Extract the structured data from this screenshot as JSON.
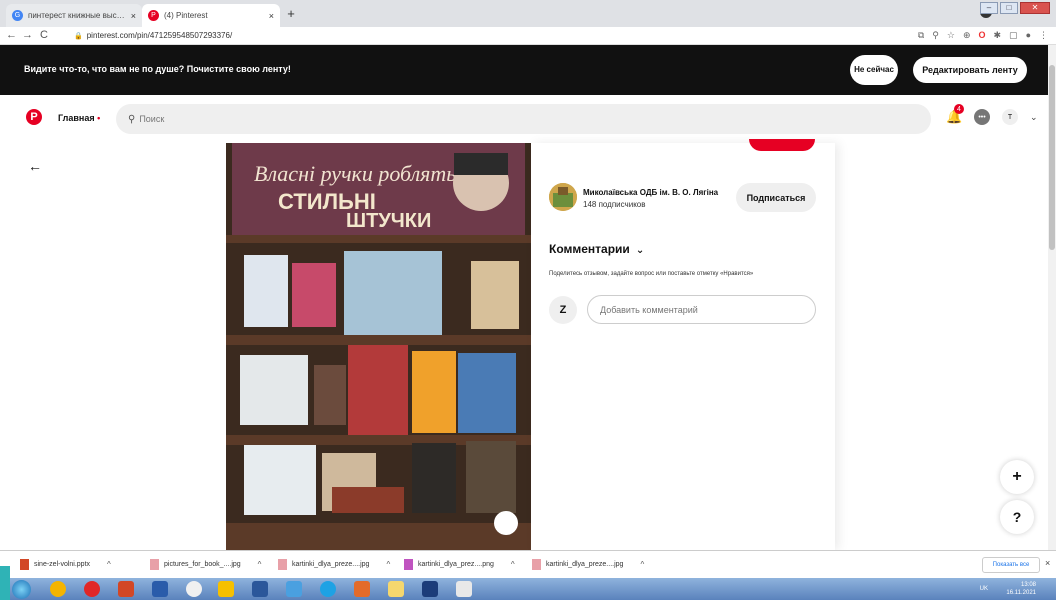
{
  "browser": {
    "tabs": [
      {
        "title": "пинтерест книжные выставки - ",
        "active": false,
        "favicon": "google-icon"
      },
      {
        "title": "(4) Pinterest",
        "active": true,
        "favicon": "pinterest-icon"
      }
    ],
    "tab_close": "×",
    "new_tab": "+",
    "url": "pinterest.com/pin/471259548507293376/"
  },
  "banner": {
    "text": "Видите что-то, что вам не по душе? Почистите свою ленту!",
    "not_now_label": "Не сейчас",
    "edit_feed_label": "Редактировать ленту"
  },
  "header": {
    "home_label": "Главная",
    "home_dot": "•",
    "search_placeholder": "Поиск",
    "notifications_count": "4",
    "avatar_letter": "T"
  },
  "pin": {
    "image_title": "Власні ручки роблять стильні штучки",
    "author": {
      "name": "Миколаївська ОДБ ім. В. О. Лягіна",
      "subscribers": "148 подписчиков"
    },
    "subscribe_label": "Подписаться",
    "comments_title": "Комментарии",
    "comments_hint": "Поделитесь отзывом, задайте вопрос или поставьте отметку «Нравится»",
    "comment_avatar": "Z",
    "comment_placeholder": "Добавить комментарий"
  },
  "fabs": {
    "plus": "+",
    "help": "?"
  },
  "downloads": {
    "items": [
      {
        "name": "sine-zel-volni.pptx",
        "type": "pptx"
      },
      {
        "name": "pictures_for_book_....jpg",
        "type": "jpg"
      },
      {
        "name": "kartinki_dlya_preze....jpg",
        "type": "jpg"
      },
      {
        "name": "kartinki_dlya_prez....png",
        "type": "png"
      },
      {
        "name": "kartinki_dlya_preze....jpg",
        "type": "jpg"
      }
    ],
    "show_all": "Показать все",
    "close": "×"
  },
  "taskbar": {
    "time": "13:08",
    "date": "16.11.2021",
    "lang": "UK"
  },
  "colors": {
    "pinterest_red": "#e60023",
    "banner_bg": "#111111",
    "search_bg": "#efefef"
  }
}
